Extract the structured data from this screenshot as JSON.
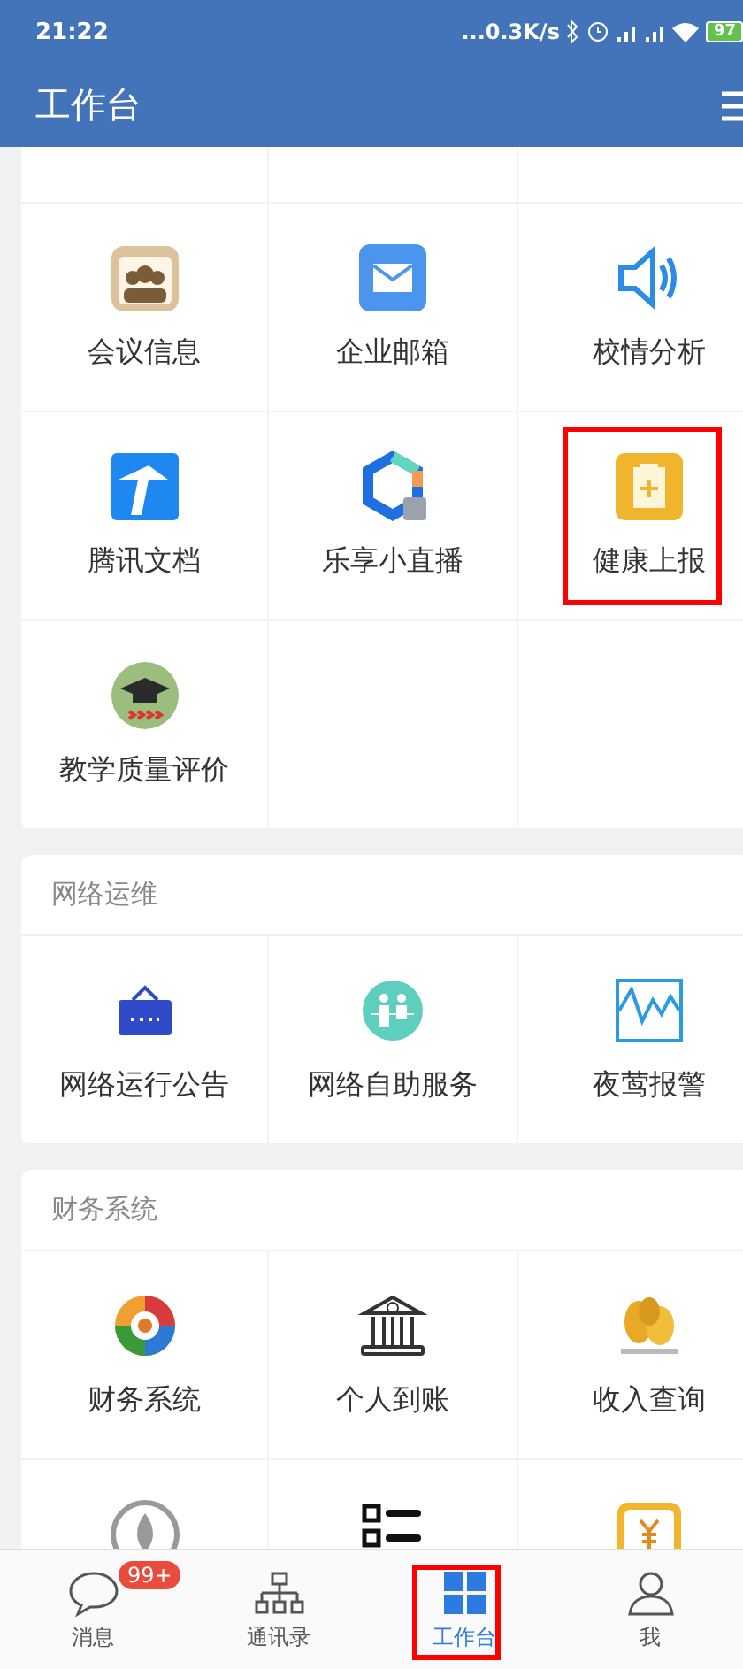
{
  "status_bar": {
    "time": "21:22",
    "speed": "...0.3K/s",
    "battery": "97"
  },
  "header": {
    "title": "工作台"
  },
  "sections": [
    {
      "items": [
        {
          "label": "会议信息",
          "highlighted": false
        },
        {
          "label": "企业邮箱",
          "highlighted": false
        },
        {
          "label": "校情分析",
          "highlighted": false
        },
        {
          "label": "腾讯文档",
          "highlighted": false
        },
        {
          "label": "乐享小直播",
          "highlighted": false
        },
        {
          "label": "健康上报",
          "highlighted": true
        },
        {
          "label": "教学质量评价",
          "highlighted": false
        }
      ]
    },
    {
      "title": "网络运维",
      "items": [
        {
          "label": "网络运行公告",
          "highlighted": false
        },
        {
          "label": "网络自助服务",
          "highlighted": false
        },
        {
          "label": "夜莺报警",
          "highlighted": false
        }
      ]
    },
    {
      "title": "财务系统",
      "items": [
        {
          "label": "财务系统",
          "highlighted": false
        },
        {
          "label": "个人到账",
          "highlighted": false
        },
        {
          "label": "收入查询",
          "highlighted": false
        },
        {
          "highlighted": false
        },
        {
          "highlighted": false
        },
        {
          "highlighted": false
        }
      ]
    }
  ],
  "tabs": [
    {
      "label": "消息",
      "badge": "99+",
      "selected": false,
      "highlighted": false
    },
    {
      "label": "通讯录",
      "selected": false,
      "highlighted": false
    },
    {
      "label": "工作台",
      "selected": true,
      "highlighted": true
    },
    {
      "label": "我",
      "selected": false,
      "highlighted": false
    }
  ]
}
